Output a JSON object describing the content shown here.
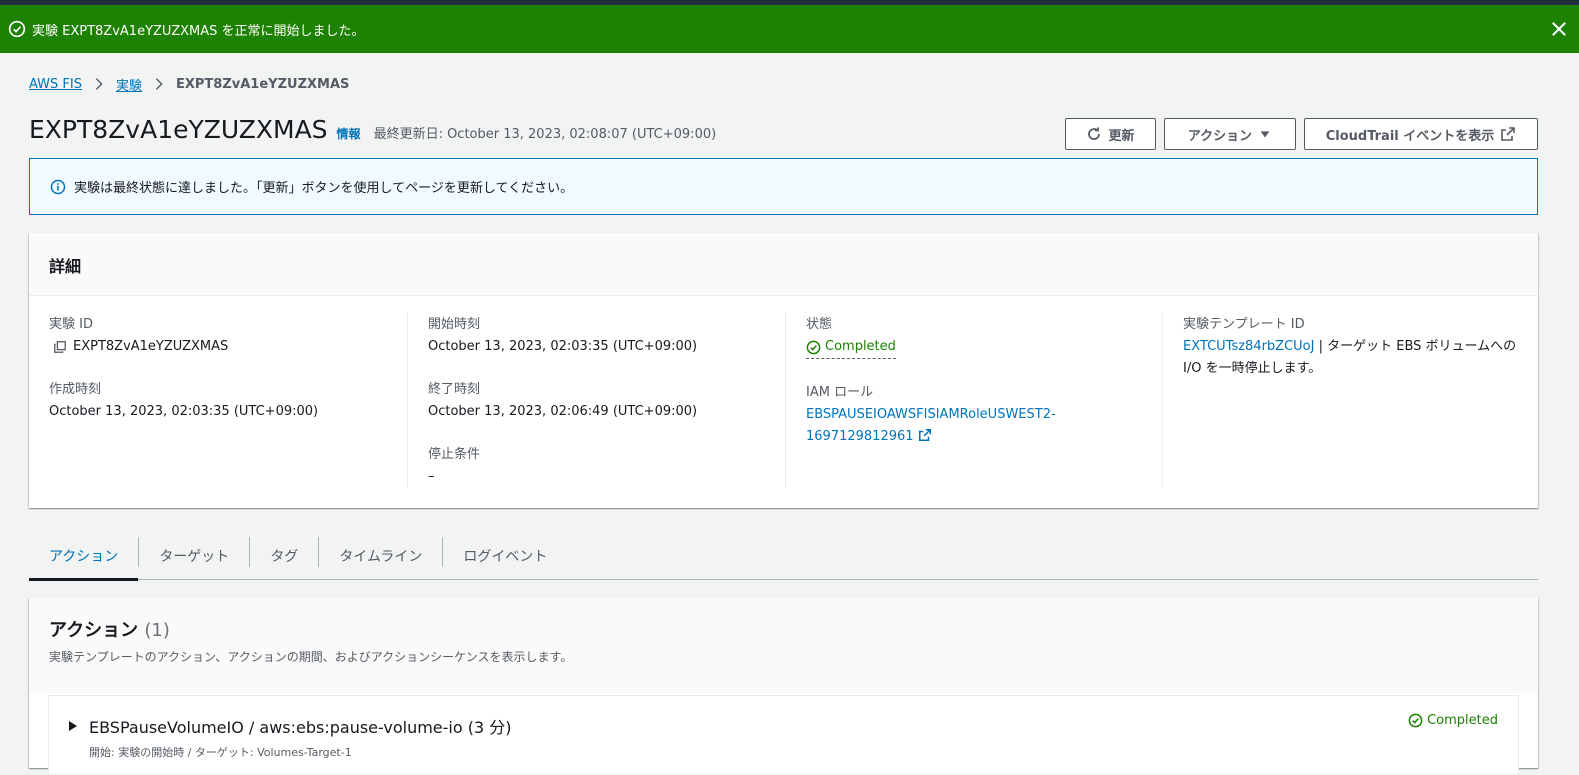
{
  "flash": {
    "message": "実験 EXPT8ZvA1eYZUZXMAS を正常に開始しました。"
  },
  "breadcrumb": {
    "items": [
      "AWS FIS",
      "実験"
    ],
    "current": "EXPT8ZvA1eYZUZXMAS"
  },
  "header": {
    "title": "EXPT8ZvA1eYZUZXMAS",
    "info": "情報",
    "last_updated": "最終更新日: October 13, 2023, 02:08:07 (UTC+09:00)",
    "refresh_label": "更新",
    "actions_label": "アクション",
    "cloudtrail_label": "CloudTrail イベントを表示"
  },
  "alert": {
    "message": "実験は最終状態に達しました。「更新」ボタンを使用してページを更新してください。"
  },
  "details": {
    "title": "詳細",
    "experiment_id_label": "実験 ID",
    "experiment_id": "EXPT8ZvA1eYZUZXMAS",
    "created_label": "作成時刻",
    "created": "October 13, 2023, 02:03:35 (UTC+09:00)",
    "start_label": "開始時刻",
    "start": "October 13, 2023, 02:03:35 (UTC+09:00)",
    "end_label": "終了時刻",
    "end": "October 13, 2023, 02:06:49 (UTC+09:00)",
    "stop_label": "停止条件",
    "stop": "–",
    "state_label": "状態",
    "state": "Completed",
    "iam_label": "IAM ロール",
    "iam_role_line1": "EBSPAUSEIOAWSFISIAMRoleUSWEST2-",
    "iam_role_line2": "1697129812961",
    "template_label": "実験テンプレート ID",
    "template_id": "EXTCUTsz84rbZCUoJ",
    "template_desc": " | ターゲット EBS ボリュームへの I/O を一時停止します。"
  },
  "tabs": [
    {
      "label": "アクション"
    },
    {
      "label": "ターゲット"
    },
    {
      "label": "タグ"
    },
    {
      "label": "タイムライン"
    },
    {
      "label": "ログイベント"
    }
  ],
  "actions_section": {
    "title": "アクション",
    "count": "(1)",
    "description": "実験テンプレートのアクション、アクションの期間、およびアクションシーケンスを表示します。",
    "items": [
      {
        "title": "EBSPauseVolumeIO / aws:ebs:pause-volume-io (3 分)",
        "subtitle": "開始: 実験の開始時 / ターゲット: Volumes-Target-1",
        "status": "Completed"
      }
    ]
  },
  "colors": {
    "success": "#1d8102",
    "link": "#0073bb",
    "info_bg": "#f1faff"
  }
}
